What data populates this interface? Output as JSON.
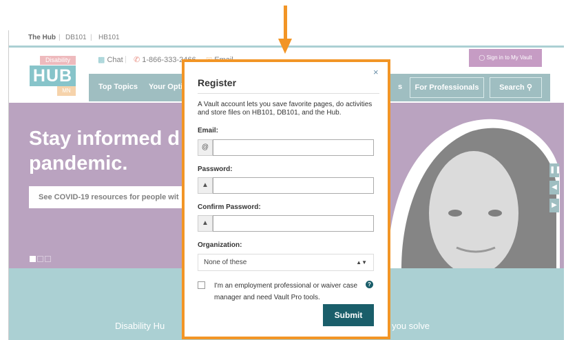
{
  "topnav": {
    "items": [
      "The Hub",
      "DB101",
      "HB101"
    ]
  },
  "logo": {
    "top": "Disability",
    "main": "HUB",
    "region": "MN"
  },
  "contact": {
    "chat": "Chat",
    "phone": "1-866-333-2466",
    "email": "Email"
  },
  "signin": {
    "label": "Sign in to My Vault"
  },
  "nav": {
    "items": [
      "Top Topics",
      "Your Opti",
      "s"
    ],
    "professionals": "For Professionals",
    "search": "Search"
  },
  "hero": {
    "line1": "Stay informed d",
    "line2": "pandemic.",
    "button": "See COVID-19 resources for people wit"
  },
  "teal": {
    "text_left": "Disability Hu",
    "text_right": "s you solve"
  },
  "modal": {
    "title": "Register",
    "close": "×",
    "description": "A Vault account lets you save favorite pages, do activities and store files on HB101, DB101, and the Hub.",
    "email_label": "Email:",
    "email_icon": "@",
    "password_label": "Password:",
    "confirm_label": "Confirm Password:",
    "organization_label": "Organization:",
    "organization_value": "None of these",
    "checkbox_text": "I'm an employment professional or waiver case manager and need Vault Pro tools.",
    "help_icon": "?",
    "submit": "Submit"
  },
  "colors": {
    "accent": "#f29526",
    "teal": "#8fc1c4",
    "hero": "#a384ab",
    "button": "#1a5e6a"
  }
}
